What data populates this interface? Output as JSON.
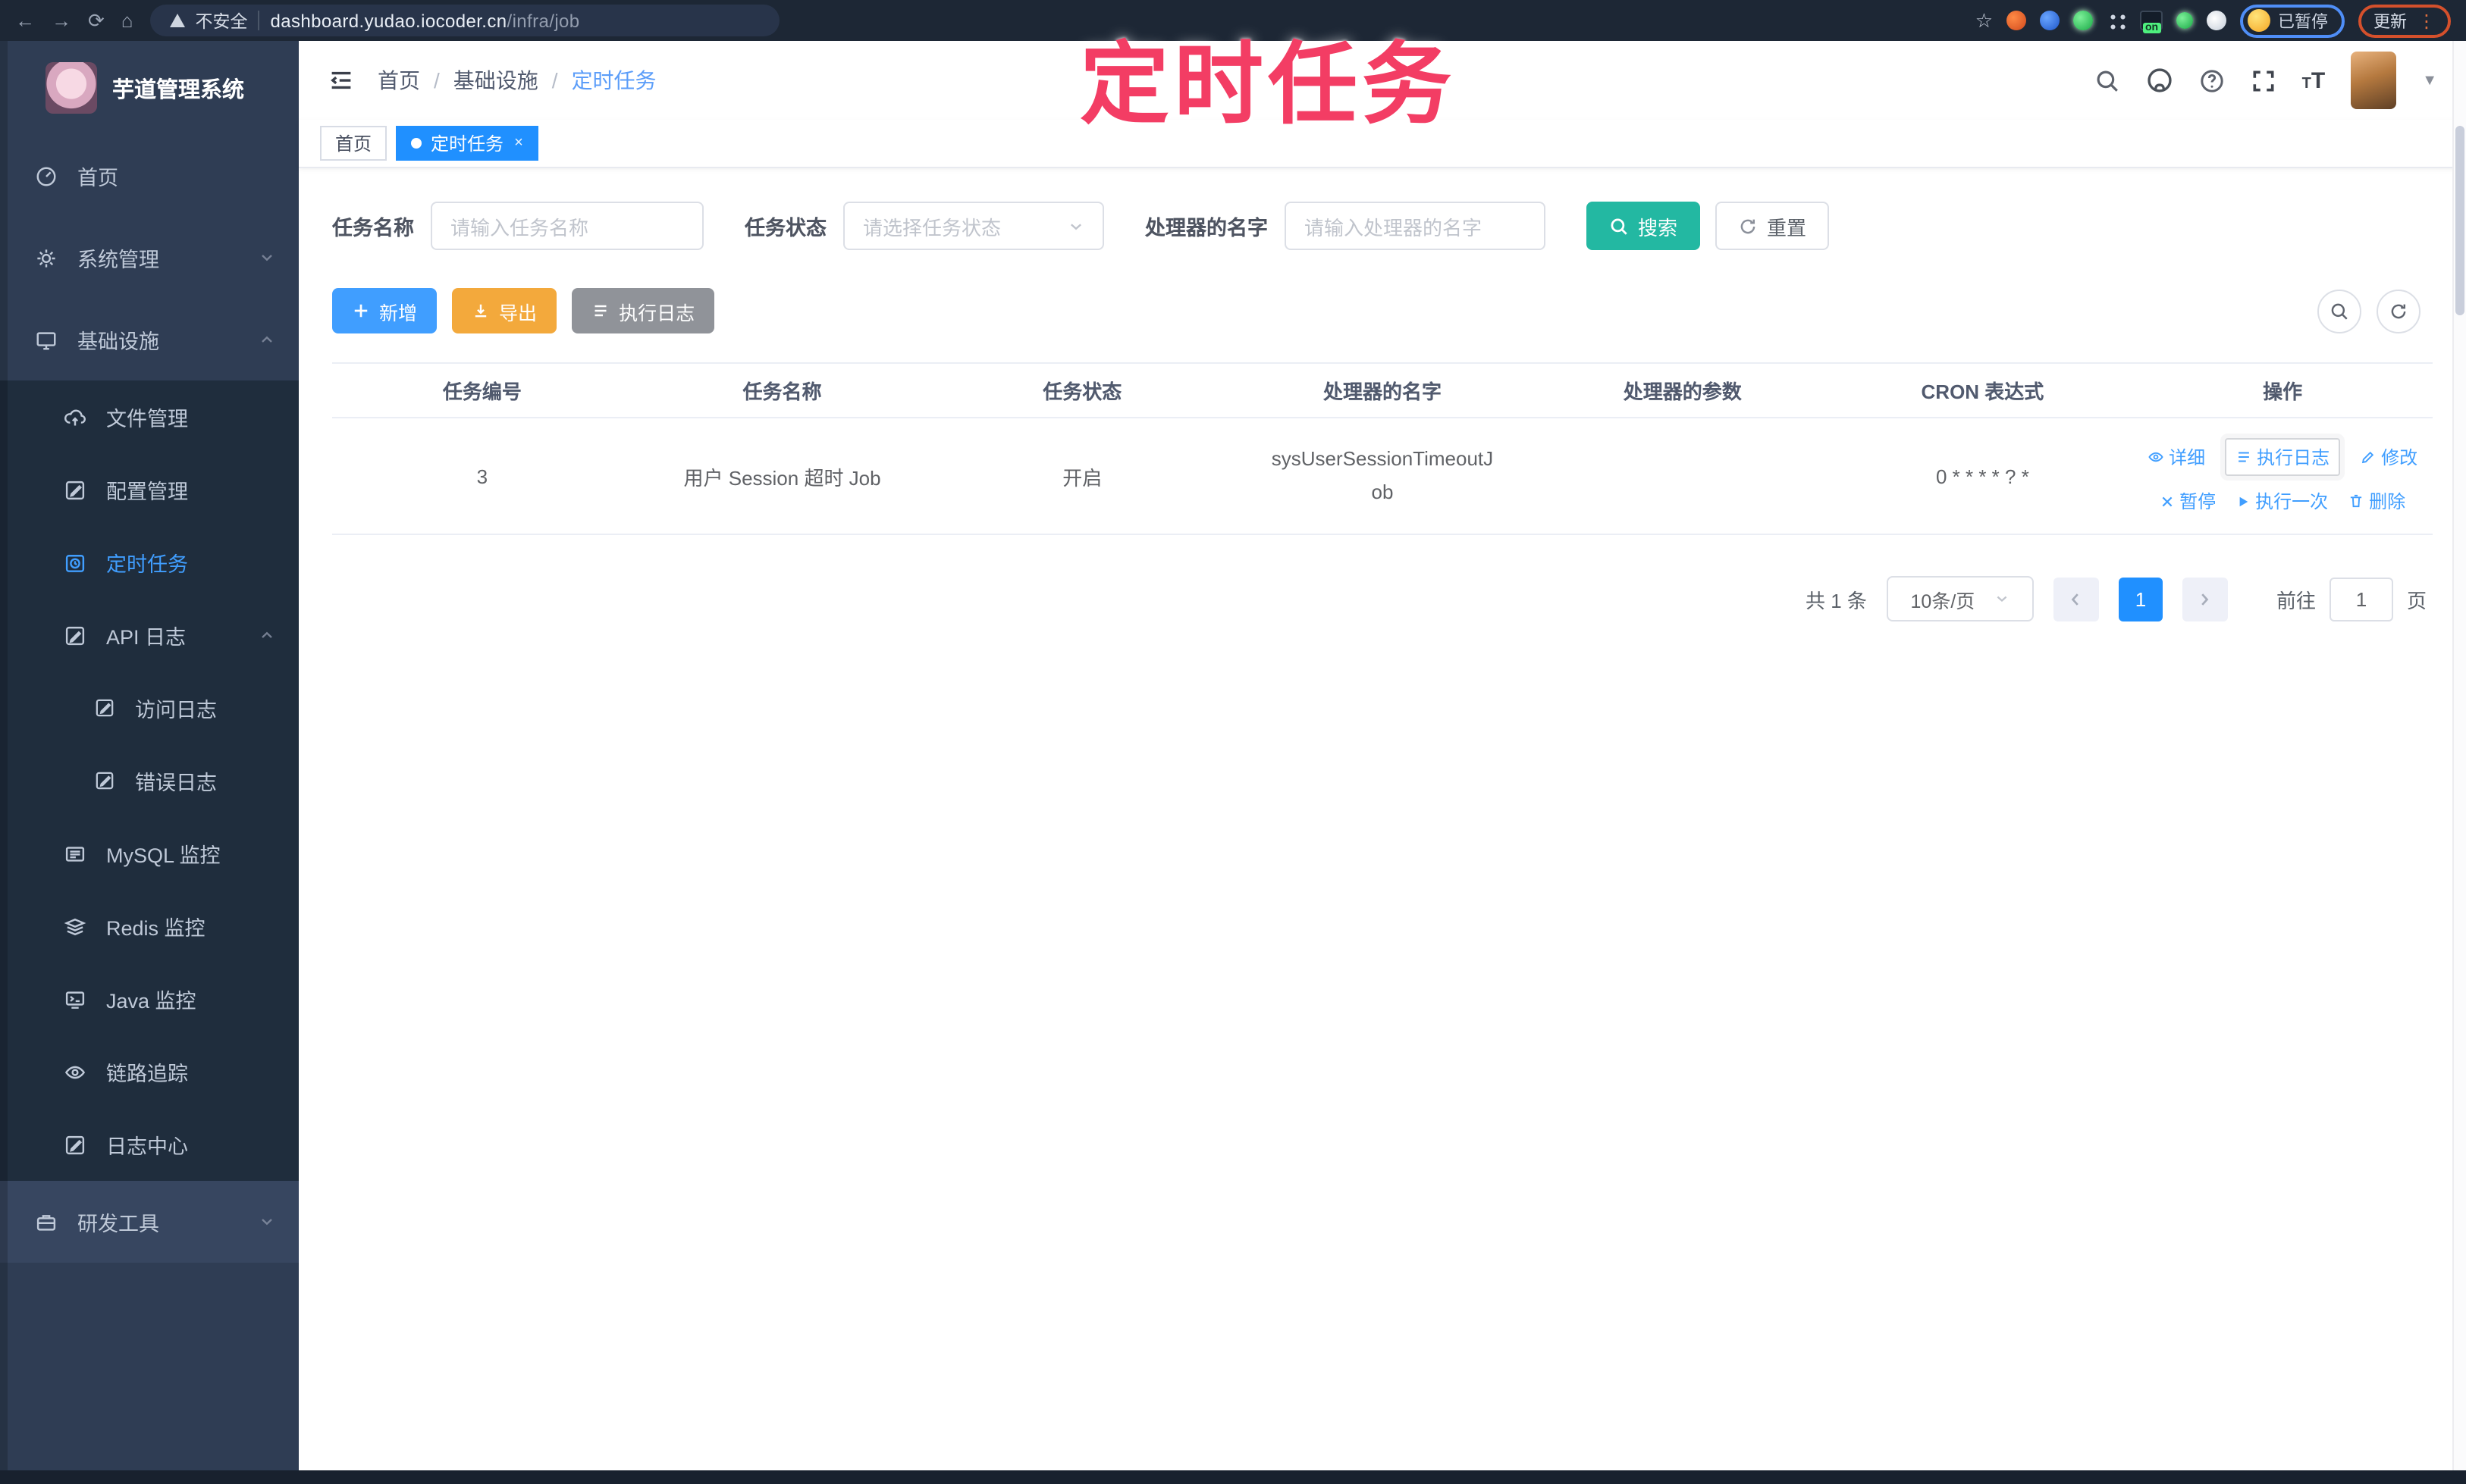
{
  "browser": {
    "security_label": "不安全",
    "url_domain": "dashboard.yudao.iocoder.cn",
    "url_path": "/infra/job",
    "ext_on_label": "on",
    "profile_label": "已暂停",
    "update_label": "更新",
    "menu_dots": "⋮",
    "star": "☆",
    "back": "←",
    "forward": "→",
    "reload": "⟳",
    "home": "⌂"
  },
  "annotation": {
    "text": "定时任务"
  },
  "sidebar": {
    "title": "芋道管理系统",
    "items": [
      {
        "label": "首页"
      },
      {
        "label": "系统管理"
      },
      {
        "label": "基础设施"
      },
      {
        "label": "文件管理"
      },
      {
        "label": "配置管理"
      },
      {
        "label": "定时任务"
      },
      {
        "label": "API 日志"
      },
      {
        "label": "访问日志"
      },
      {
        "label": "错误日志"
      },
      {
        "label": "MySQL 监控"
      },
      {
        "label": "Redis 监控"
      },
      {
        "label": "Java 监控"
      },
      {
        "label": "链路追踪"
      },
      {
        "label": "日志中心"
      },
      {
        "label": "研发工具"
      }
    ]
  },
  "header": {
    "breadcrumb": [
      "首页",
      "基础设施",
      "定时任务"
    ]
  },
  "tabs": [
    {
      "label": "首页"
    },
    {
      "label": "定时任务",
      "close": "×"
    }
  ],
  "filters": {
    "name_label": "任务名称",
    "name_placeholder": "请输入任务名称",
    "status_label": "任务状态",
    "status_placeholder": "请选择任务状态",
    "handler_label": "处理器的名字",
    "handler_placeholder": "请输入处理器的名字",
    "search_label": "搜索",
    "reset_label": "重置"
  },
  "toolbar": {
    "add_label": "新增",
    "export_label": "导出",
    "runlog_label": "执行日志"
  },
  "table": {
    "headers": [
      "任务编号",
      "任务名称",
      "任务状态",
      "处理器的名字",
      "处理器的参数",
      "CRON 表达式",
      "操作"
    ],
    "rows": [
      {
        "id": "3",
        "name": "用户 Session 超时 Job",
        "status": "开启",
        "handler": "sysUserSessionTimeoutJob",
        "param": "",
        "cron": "0 * * * * ? *",
        "actions": [
          "详细",
          "执行日志",
          "修改",
          "暂停",
          "执行一次",
          "删除"
        ]
      }
    ]
  },
  "pagination": {
    "total": "共 1 条",
    "page_size": "10条/页",
    "current_page": "1",
    "goto_prefix": "前往",
    "goto_value": "1",
    "goto_suffix": "页"
  },
  "colors": {
    "accent_blue": "#409eff",
    "tag_active_blue": "#2090ff",
    "search_button_teal": "#23b8a2",
    "export_button_orange": "#f3a93c",
    "info_button_gray": "#909399",
    "sidebar_bg": "#2f3d54",
    "submenu_bg": "#1f2d3d",
    "annotation_pink": "#f33d64"
  }
}
